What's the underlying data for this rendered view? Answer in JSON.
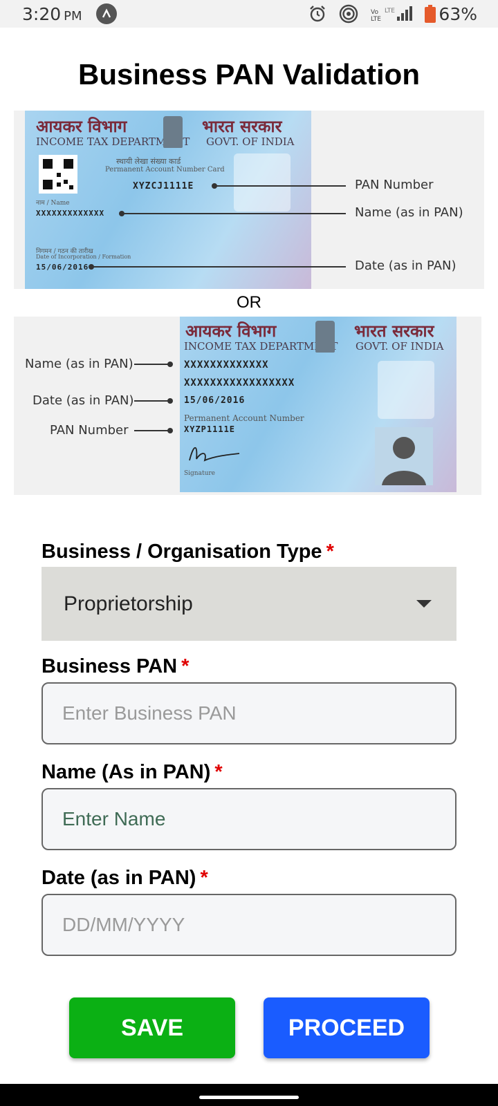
{
  "status_bar": {
    "time": "3:20",
    "ampm": "PM",
    "battery": "63%",
    "net": "LTE",
    "icons": [
      "alarm-icon",
      "hotspot-icon",
      "volte-icon",
      "signal-icon",
      "battery-icon"
    ]
  },
  "page": {
    "title": "Business PAN Validation"
  },
  "pan_card_1": {
    "hindi_dept": "आयकर विभाग",
    "hindi_govt": "भारत सरकार",
    "dept": "INCOME TAX DEPARTMENT",
    "govt": "GOVT. OF INDIA",
    "hindi_pan_card": "स्थायी लेखा संख्या कार्ड",
    "pan_card_label": "Permanent Account Number Card",
    "pan_value": "XYZCJ1111E",
    "name_caption": "नाम / Name",
    "name_value": "XXXXXXXXXXXXX",
    "date_caption_hi": "निगमन / गठन की तारीख",
    "date_caption": "Date of Incorporation / Formation",
    "date_value": "15/06/2016",
    "callouts": [
      "PAN Number",
      "Name (as in PAN)",
      "Date (as in PAN)"
    ]
  },
  "or_label": "OR",
  "pan_card_2": {
    "hindi_dept": "आयकर विभाग",
    "hindi_govt": "भारत सरकार",
    "dept": "INCOME TAX DEPARTMENT",
    "govt": "GOVT. OF INDIA",
    "name_value_1": "XXXXXXXXXXXXX",
    "name_value_2": "XXXXXXXXXXXXXXXXX",
    "date_value": "15/06/2016",
    "pan_caption": "Permanent Account Number",
    "pan_value": "XYZP1111E",
    "signature_caption": "Signature",
    "callouts": [
      "Name (as in PAN)",
      "Date (as in PAN)",
      "PAN Number"
    ]
  },
  "form": {
    "org_type": {
      "label": "Business / Organisation Type",
      "required_mark": "*",
      "selected": "Proprietorship"
    },
    "pan": {
      "label": "Business PAN",
      "required_mark": "*",
      "placeholder": "Enter Business PAN"
    },
    "name": {
      "label": "Name (As in PAN)",
      "required_mark": "*",
      "placeholder": "Enter Name"
    },
    "date": {
      "label": "Date (as in PAN)",
      "required_mark": "*",
      "placeholder": "DD/MM/YYYY"
    }
  },
  "actions": {
    "save": "SAVE",
    "proceed": "PROCEED"
  },
  "colors": {
    "save": "#0bb014",
    "proceed": "#1a5cff",
    "required": "#e00000"
  }
}
